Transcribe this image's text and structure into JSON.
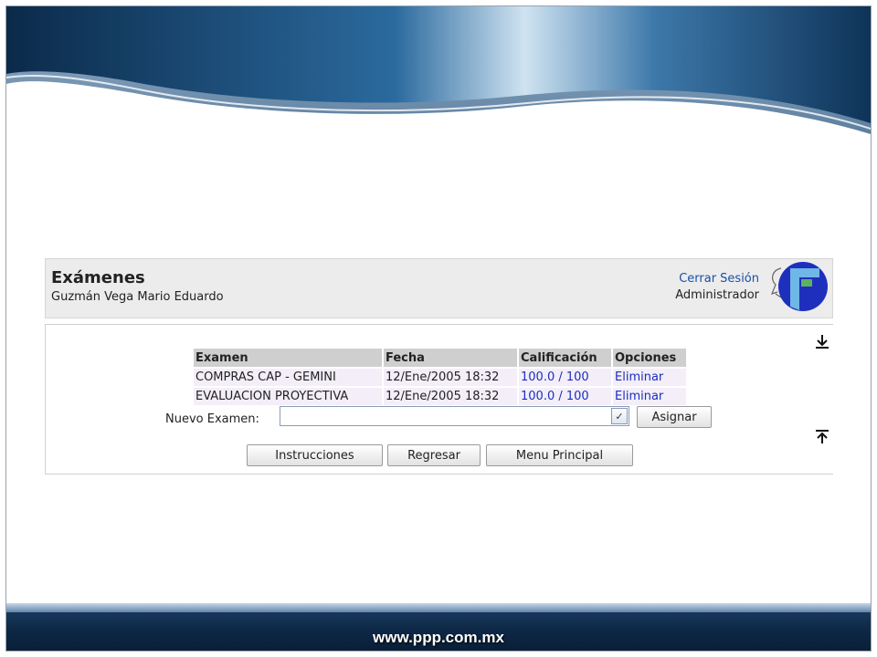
{
  "header": {
    "title": "Exámenes",
    "user_name": "Guzmán Vega Mario Eduardo",
    "logout_label": "Cerrar Sesión",
    "role": "Administrador"
  },
  "table": {
    "columns": [
      "Examen",
      "Fecha",
      "Calificación",
      "Opciones"
    ],
    "rows": [
      {
        "exam": "COMPRAS CAP - GEMINI",
        "date": "12/Ene/2005 18:32",
        "score": "100.0 / 100",
        "option": "Eliminar"
      },
      {
        "exam": "EVALUACION PROYECTIVA",
        "date": "12/Ene/2005 18:32",
        "score": "100.0 / 100",
        "option": "Eliminar"
      }
    ]
  },
  "new_exam": {
    "label": "Nuevo Examen:",
    "selected": "",
    "assign_label": "Asignar"
  },
  "actions": {
    "instructions_label": "Instrucciones",
    "back_label": "Regresar",
    "main_menu_label": "Menu Principal"
  },
  "footer": {
    "url": "www.ppp.com.mx"
  },
  "icons": {
    "scroll_down": "arrow-down-to-line-icon",
    "scroll_up": "arrow-up-to-line-icon"
  },
  "colors": {
    "banner_dark": "#0d2745",
    "link_blue": "#1a2fbf",
    "header_bg": "#ececec"
  }
}
